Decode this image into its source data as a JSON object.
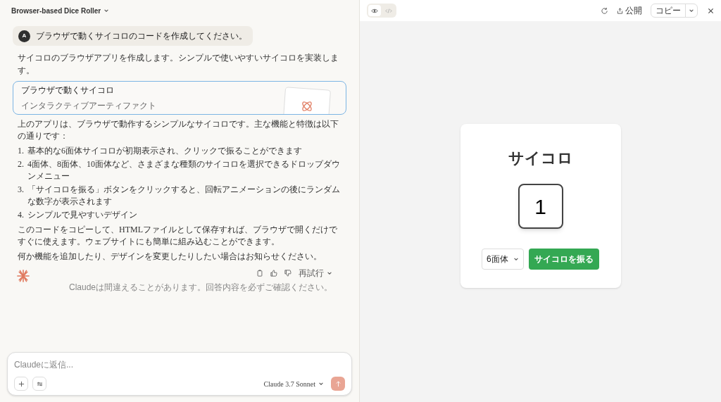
{
  "chat": {
    "title": "Browser-based Dice Roller",
    "user_message": {
      "avatar": "A",
      "text": "ブラウザで動くサイコロのコードを作成してください。"
    },
    "intro": "サイコロのブラウザアプリを作成します。シンプルで使いやすいサイコロを実装します。",
    "artifact_card": {
      "title": "ブラウザで動くサイコロ",
      "subtitle": "インタラクティブアーティファクト"
    },
    "paragraph": "上のアプリは、ブラウザで動作するシンプルなサイコロです。主な機能と特徴は以下の通りです：",
    "list": [
      {
        "number": "1.",
        "text": "基本的な6面体サイコロが初期表示され、クリックで振ることができます"
      },
      {
        "number": "2.",
        "text": "4面体、8面体、10面体など、さまざまな種類のサイコロを選択できるドロップダウンメニュー"
      },
      {
        "number": "3.",
        "text": "「サイコロを振る」ボタンをクリックすると、回転アニメーションの後にランダムな数字が表示されます"
      },
      {
        "number": "4.",
        "text": "シンプルで見やすいデザイン"
      }
    ],
    "paragraphs": [
      "このコードをコピーして、HTMLファイルとして保存すれば、ブラウザで開くだけですぐに使えます。ウェブサイトにも簡単に組み込むことができます。",
      "何か機能を追加したり、デザインを変更したりしたい場合はお知らせください。"
    ],
    "retry_label": "再試行",
    "disclaimer": "Claudeは間違えることがあります。回答内容を必ずご確認ください。",
    "input": {
      "placeholder": "Claudeに返信...",
      "model": "Claude 3.7 Sonnet"
    }
  },
  "preview": {
    "view_tabs": [
      {
        "kind": "preview",
        "selected": true
      },
      {
        "kind": "code",
        "selected": false
      }
    ],
    "publish_label": "公開",
    "copy_label": "コピー",
    "app": {
      "title": "サイコロ",
      "die_value": "1",
      "select_value": "6面体",
      "roll_button": "サイコロを振る"
    }
  }
}
